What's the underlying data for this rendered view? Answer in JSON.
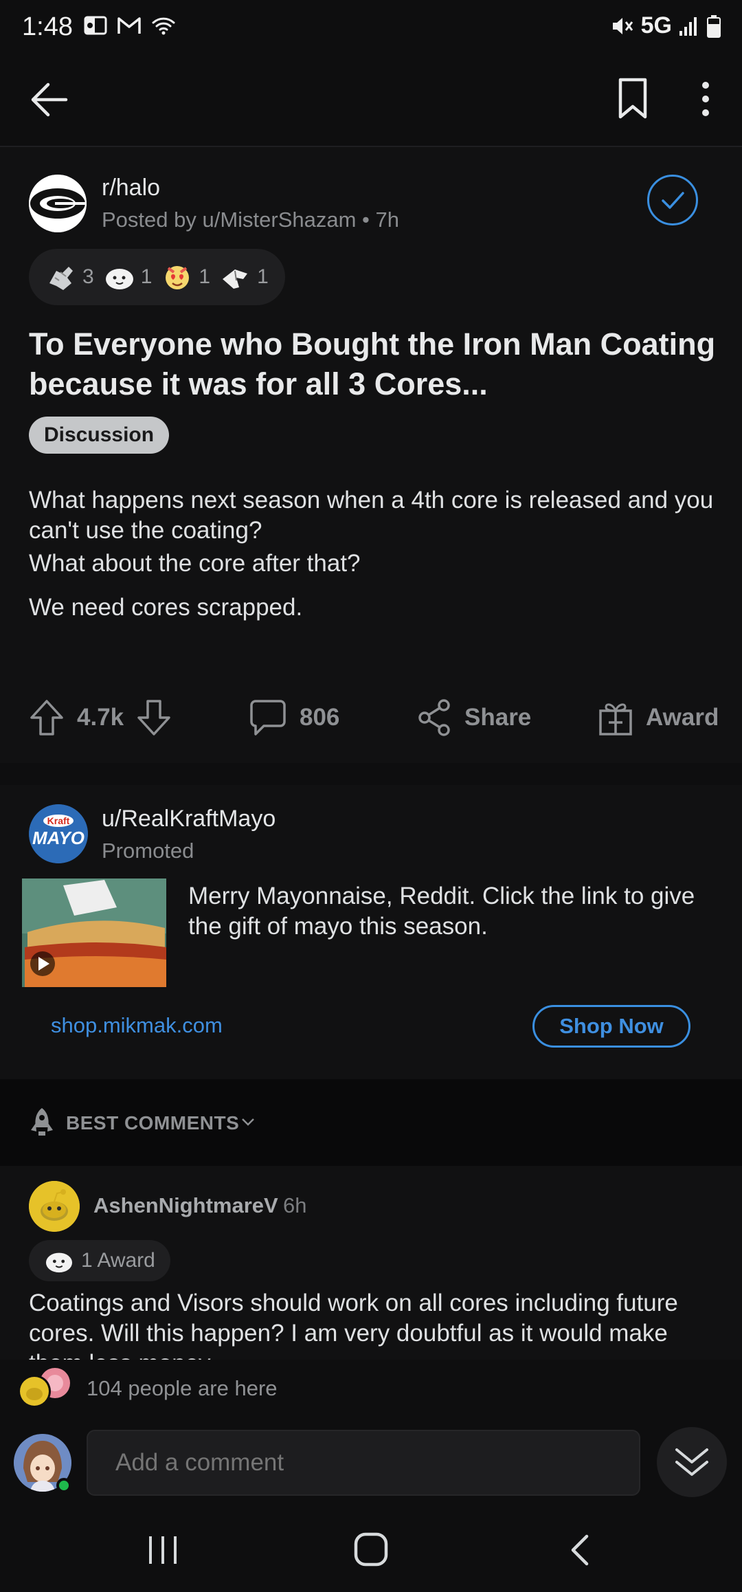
{
  "status_bar": {
    "time": "1:48",
    "network": "5G"
  },
  "post": {
    "subreddit": "r/halo",
    "posted_by": "Posted by u/MisterShazam • 7h",
    "awards": [
      {
        "icon": "helpful-hand-icon",
        "count": "3"
      },
      {
        "icon": "wholesome-seal-icon",
        "count": "1"
      },
      {
        "icon": "heart-eyes-icon",
        "count": "1"
      },
      {
        "icon": "hand-pointing-icon",
        "count": "1"
      }
    ],
    "title": "To Everyone who Bought the Iron Man Coating because it was for all 3 Cores...",
    "flair": "Discussion",
    "body": [
      "What happens next season when a 4th core is released and you can't use the coating?",
      "What about the core after that?",
      "We need cores scrapped."
    ],
    "votes": "4.7k",
    "comments": "806",
    "share_label": "Share",
    "award_label": "Award"
  },
  "promoted": {
    "user": "u/RealKraftMayo",
    "tag": "Promoted",
    "logo_text": "Kraft",
    "logo_sub": "MAYO",
    "text": "Merry Mayonnaise, Reddit. Click the link to give the gift of mayo this season.",
    "link": "shop.mikmak.com",
    "cta": "Shop Now"
  },
  "sort": {
    "label": "BEST COMMENTS"
  },
  "comment": {
    "user": "AshenNightmareV",
    "time": "6h",
    "award": "1 Award",
    "body": "Coatings and Visors should work on all cores including future cores. Will this happen? I am very doubtful as it would make them less money."
  },
  "presence": "104 people are here",
  "composer": {
    "placeholder": "Add a comment"
  },
  "colors": {
    "accent": "#3a8fe0",
    "background": "#0e0e0f",
    "card": "#111112",
    "online": "#1fb94c"
  }
}
